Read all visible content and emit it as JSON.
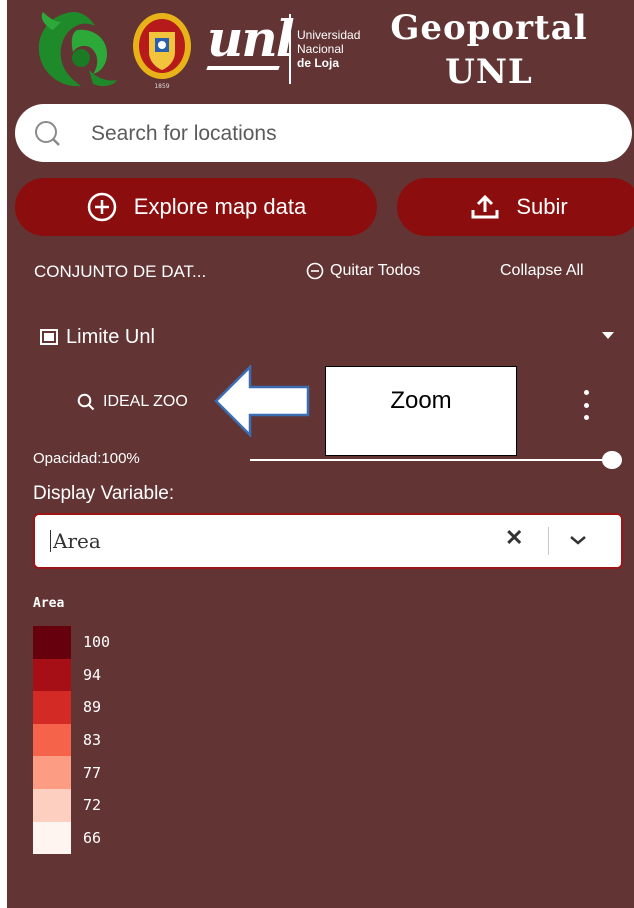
{
  "header": {
    "university_lines": [
      "Universidad",
      "Nacional",
      "de Loja"
    ],
    "unl_logo_text": "unl",
    "seal_year": "1859",
    "title_line1": "Geoportal",
    "title_line2": "UNL"
  },
  "search": {
    "placeholder": "Search for locations",
    "icon": "search-icon"
  },
  "actions": {
    "explore_label": "Explore map data",
    "explore_icon": "plus-circle-icon",
    "upload_label": "Subir",
    "upload_icon": "upload-icon"
  },
  "dataset": {
    "title": "CONJUNTO DE DAT...",
    "remove_all_label": "Quitar Todos",
    "collapse_label": "Collapse All"
  },
  "layer": {
    "name": "Limite Unl",
    "ideal_zoom_label": "IDEAL ZOO",
    "opacity_label": "Opacidad:",
    "opacity_value": "100%",
    "opacity": 1.0,
    "display_variable_label": "Display Variable:",
    "display_variable_value": "Area"
  },
  "annotation": {
    "callout_text": "Zoom"
  },
  "legend": {
    "title": "Area",
    "items": [
      {
        "label": "100",
        "color": "#67000d"
      },
      {
        "label": "94",
        "color": "#a50f15"
      },
      {
        "label": "89",
        "color": "#d42a25"
      },
      {
        "label": "83",
        "color": "#f4634a"
      },
      {
        "label": "77",
        "color": "#fc9c82"
      },
      {
        "label": "72",
        "color": "#fdcfc0"
      },
      {
        "label": "66",
        "color": "#fff5f0"
      }
    ]
  },
  "colors": {
    "panel_bg": "#633434",
    "button_bg": "#8c0d0d",
    "select_border": "#9a1515"
  }
}
